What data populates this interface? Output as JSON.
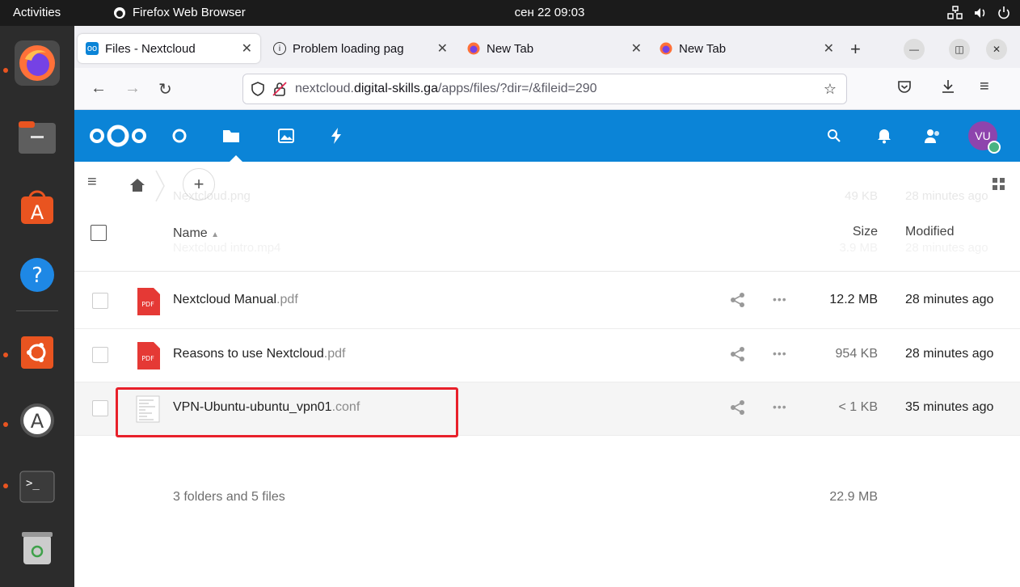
{
  "topbar": {
    "activities": "Activities",
    "app_name": "Firefox Web Browser",
    "clock": "сен 22  09:03"
  },
  "tabs": [
    {
      "label": "Files - Nextcloud",
      "active": true
    },
    {
      "label": "Problem loading pag",
      "active": false
    },
    {
      "label": "New Tab",
      "active": false
    },
    {
      "label": "New Tab",
      "active": false
    }
  ],
  "navbar": {
    "url_host": "nextcloud.",
    "url_domain": "digital-skills.ga",
    "url_path": "/apps/files/?dir=/&fileid=290"
  },
  "header": {
    "avatar_initials": "VU",
    "brand_color": "#0b84d7"
  },
  "files": {
    "ghost_rows": [
      {
        "name": "Nextcloud.png",
        "size": "49 KB",
        "modified": "28 minutes ago"
      },
      {
        "name": "Nextcloud intro.mp4",
        "size": "3.9 MB",
        "modified": "28 minutes ago"
      }
    ],
    "columns": {
      "name": "Name",
      "size": "Size",
      "modified": "Modified"
    },
    "rows": [
      {
        "base": "Nextcloud Manual",
        "ext": ".pdf",
        "size": "12.2 MB",
        "modified": "28 minutes ago",
        "type": "pdf",
        "icon_label": "PDF"
      },
      {
        "base": "Reasons to use Nextcloud",
        "ext": ".pdf",
        "size": "954 KB",
        "modified": "28 minutes ago",
        "type": "pdf",
        "icon_label": "PDF"
      },
      {
        "base": "VPN-Ubuntu-ubuntu_vpn01",
        "ext": ".conf",
        "size": "< 1 KB",
        "modified": "35 minutes ago",
        "type": "text"
      }
    ],
    "summary": {
      "text": "3 folders and 5 files",
      "total_size": "22.9 MB"
    }
  },
  "colors": {
    "highlight": "#e8202a",
    "pdf": "#e53935"
  }
}
